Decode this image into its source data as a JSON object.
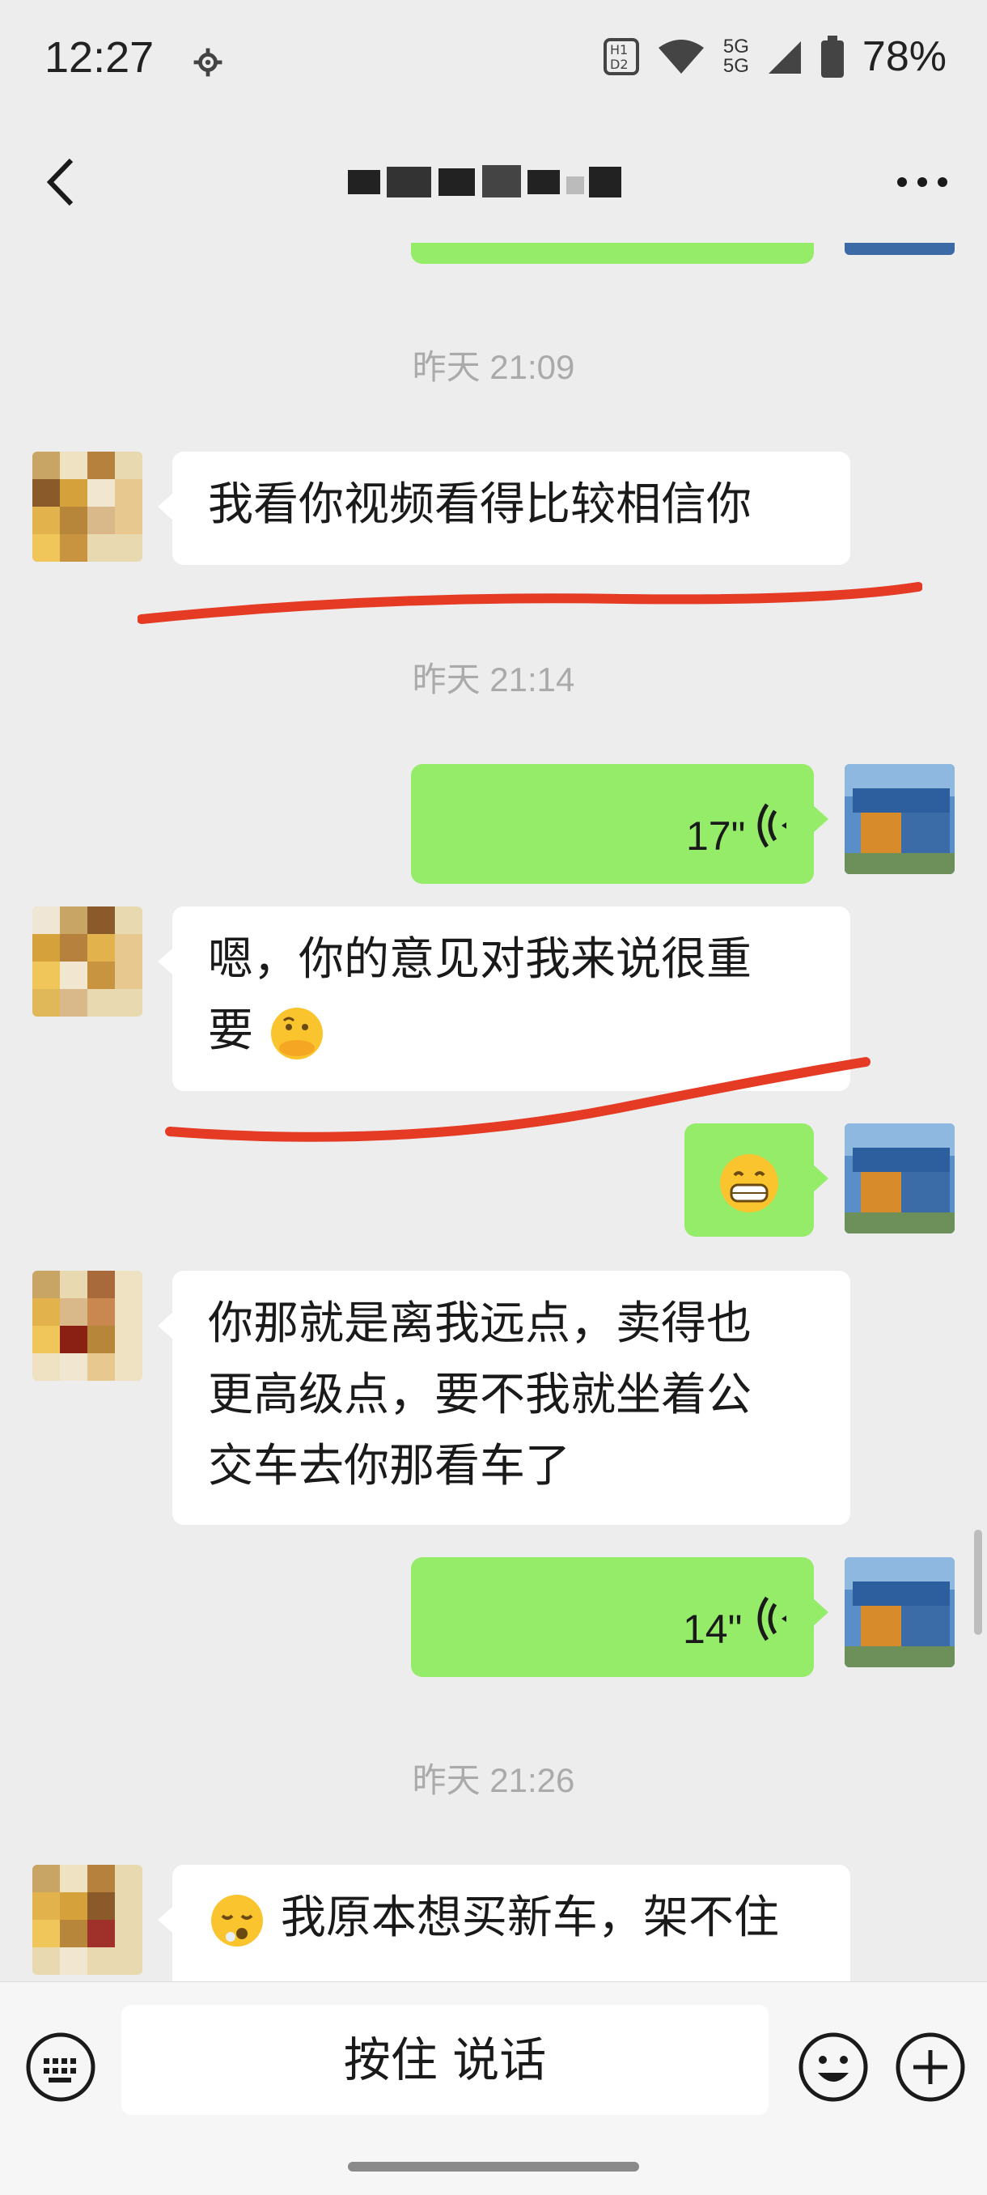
{
  "status_bar": {
    "time": "12:27",
    "battery": "78%",
    "network_label_1": "5G",
    "network_label_2": "5G"
  },
  "header": {
    "title": "",
    "back_icon": "chevron-left-icon",
    "more_icon": "more-dots-icon"
  },
  "messages": {
    "ts1": "昨天 21:09",
    "m1": "我看你视频看得比较相信你",
    "ts2": "昨天 21:14",
    "v1": "17\"",
    "m2_line1": "嗯，你的意见对我来说很重",
    "m2_line2": "要",
    "m3_line1": "你那就是离我远点，卖得也",
    "m3_line2": "更高级点，要不我就坐着公",
    "m3_line3": "交车去你那看车了",
    "v2": "14\"",
    "ts3": "昨天 21:26",
    "m4_line1": "我原本想买新车，架不住"
  },
  "input_bar": {
    "hold_to_talk": "按住 说话"
  },
  "colors": {
    "background": "#ededed",
    "bubble_self": "#95ec69",
    "bubble_other": "#ffffff",
    "annotation": "#e53a24"
  }
}
